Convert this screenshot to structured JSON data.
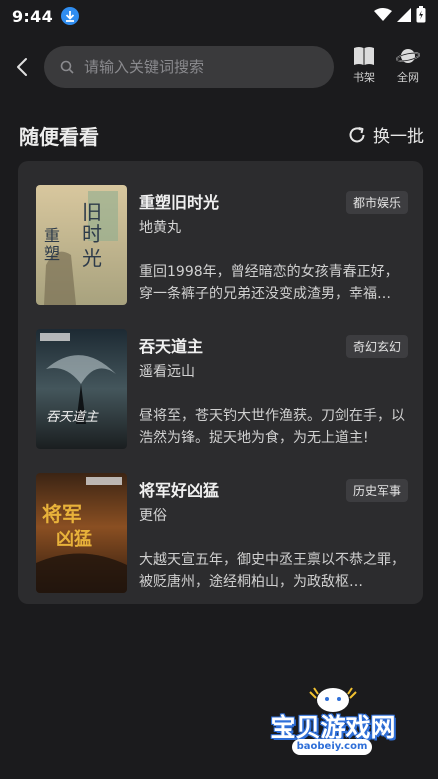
{
  "status": {
    "time": "9:44"
  },
  "search": {
    "placeholder": "请输入关键词搜索"
  },
  "toolbar": {
    "bookshelf_label": "书架",
    "network_label": "全网"
  },
  "section": {
    "title": "随便看看",
    "refresh_label": "换一批"
  },
  "books": [
    {
      "title": "重塑旧时光",
      "author": "地黄丸",
      "tag": "都市娱乐",
      "desc": "重回1998年，曾经暗恋的女孩青春正好，穿一条裤子的兄弟还没变成渣男，幸福…",
      "cover_text": "重塑旧时光"
    },
    {
      "title": "吞天道主",
      "author": "遥看远山",
      "tag": "奇幻玄幻",
      "desc": "昼将至，苍天钓大世作渔获。刀剑在手，以浩然为锋。捉天地为食，为无上道主!",
      "cover_text": "吞天道主"
    },
    {
      "title": "将军好凶猛",
      "author": "更俗",
      "tag": "历史军事",
      "desc": "大越天宣五年，御史中丞王禀以不恭之罪，被贬唐州，途经桐柏山，为政敌枢…",
      "cover_text": "将军好凶猛"
    }
  ],
  "watermark": {
    "title": "宝贝游戏网",
    "url": "baobeiy.com"
  },
  "colors": {
    "background": "#1b1b1d",
    "card": "#2c2c2e",
    "search": "#3a3a3c",
    "tag": "#3d3d40",
    "accent": "#2f8df0"
  }
}
